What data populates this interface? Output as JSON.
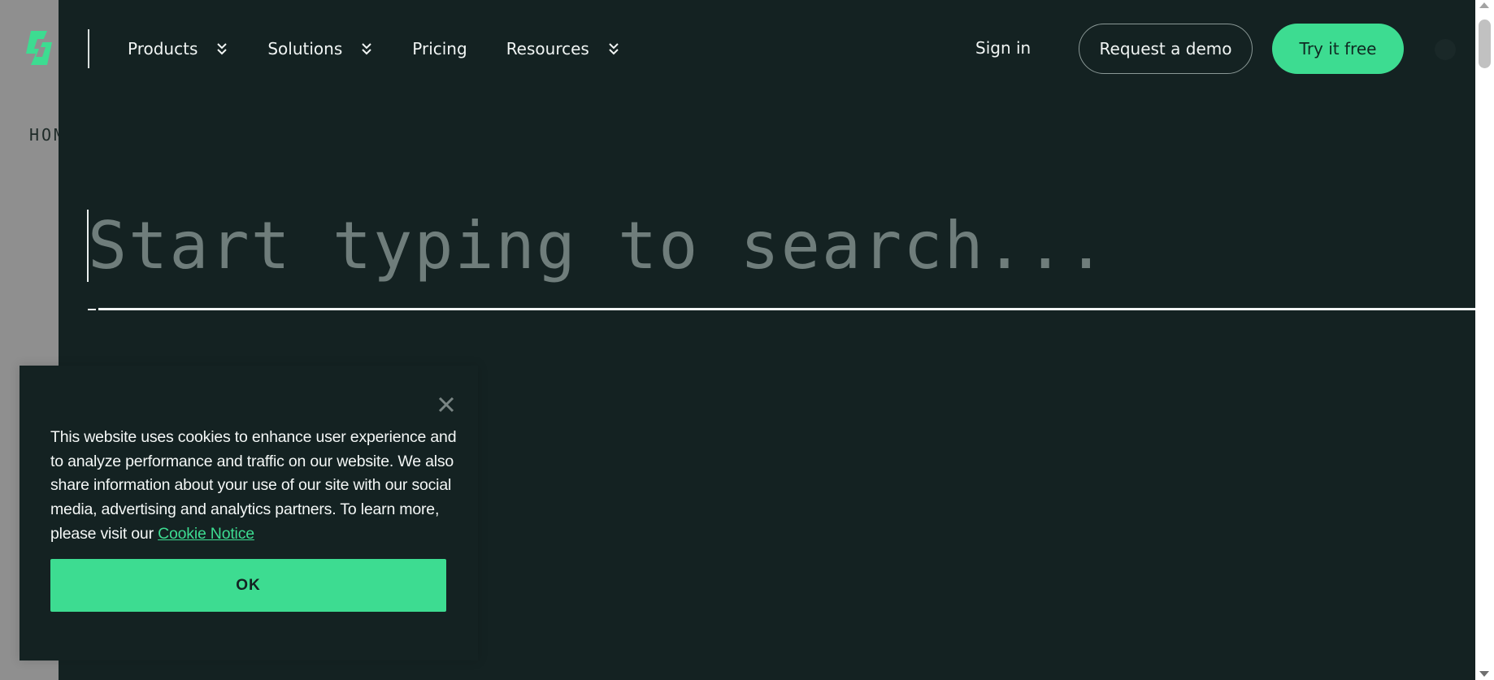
{
  "background_page": {
    "breadcrumb_partial": "HOM"
  },
  "header": {
    "logo_icon": "brand-logo-icon",
    "nav": [
      {
        "label": "Products",
        "has_dropdown": true,
        "icon": "double-chevron-down-icon"
      },
      {
        "label": "Solutions",
        "has_dropdown": true,
        "icon": "double-chevron-down-icon"
      },
      {
        "label": "Pricing",
        "has_dropdown": false
      },
      {
        "label": "Resources",
        "has_dropdown": true,
        "icon": "double-chevron-down-icon"
      }
    ],
    "sign_in": "Sign in",
    "request_demo": "Request a demo",
    "try_free": "Try it free"
  },
  "search": {
    "value": "",
    "placeholder": "Start typing to search..."
  },
  "cookie_banner": {
    "text": "This website uses cookies to enhance user experience and to analyze performance and traffic on our website. We also share information about your use of our site with our social media, advertising and analytics partners. To learn more, please visit our ",
    "link_text": "Cookie Notice",
    "ok_label": "OK",
    "close_icon": "close-icon"
  },
  "colors": {
    "panel_bg": "#142222",
    "accent": "#3ddc91",
    "text": "#f1f5f4",
    "placeholder": "#6f7d7b",
    "dimmed_page": "#8f8f8f"
  }
}
